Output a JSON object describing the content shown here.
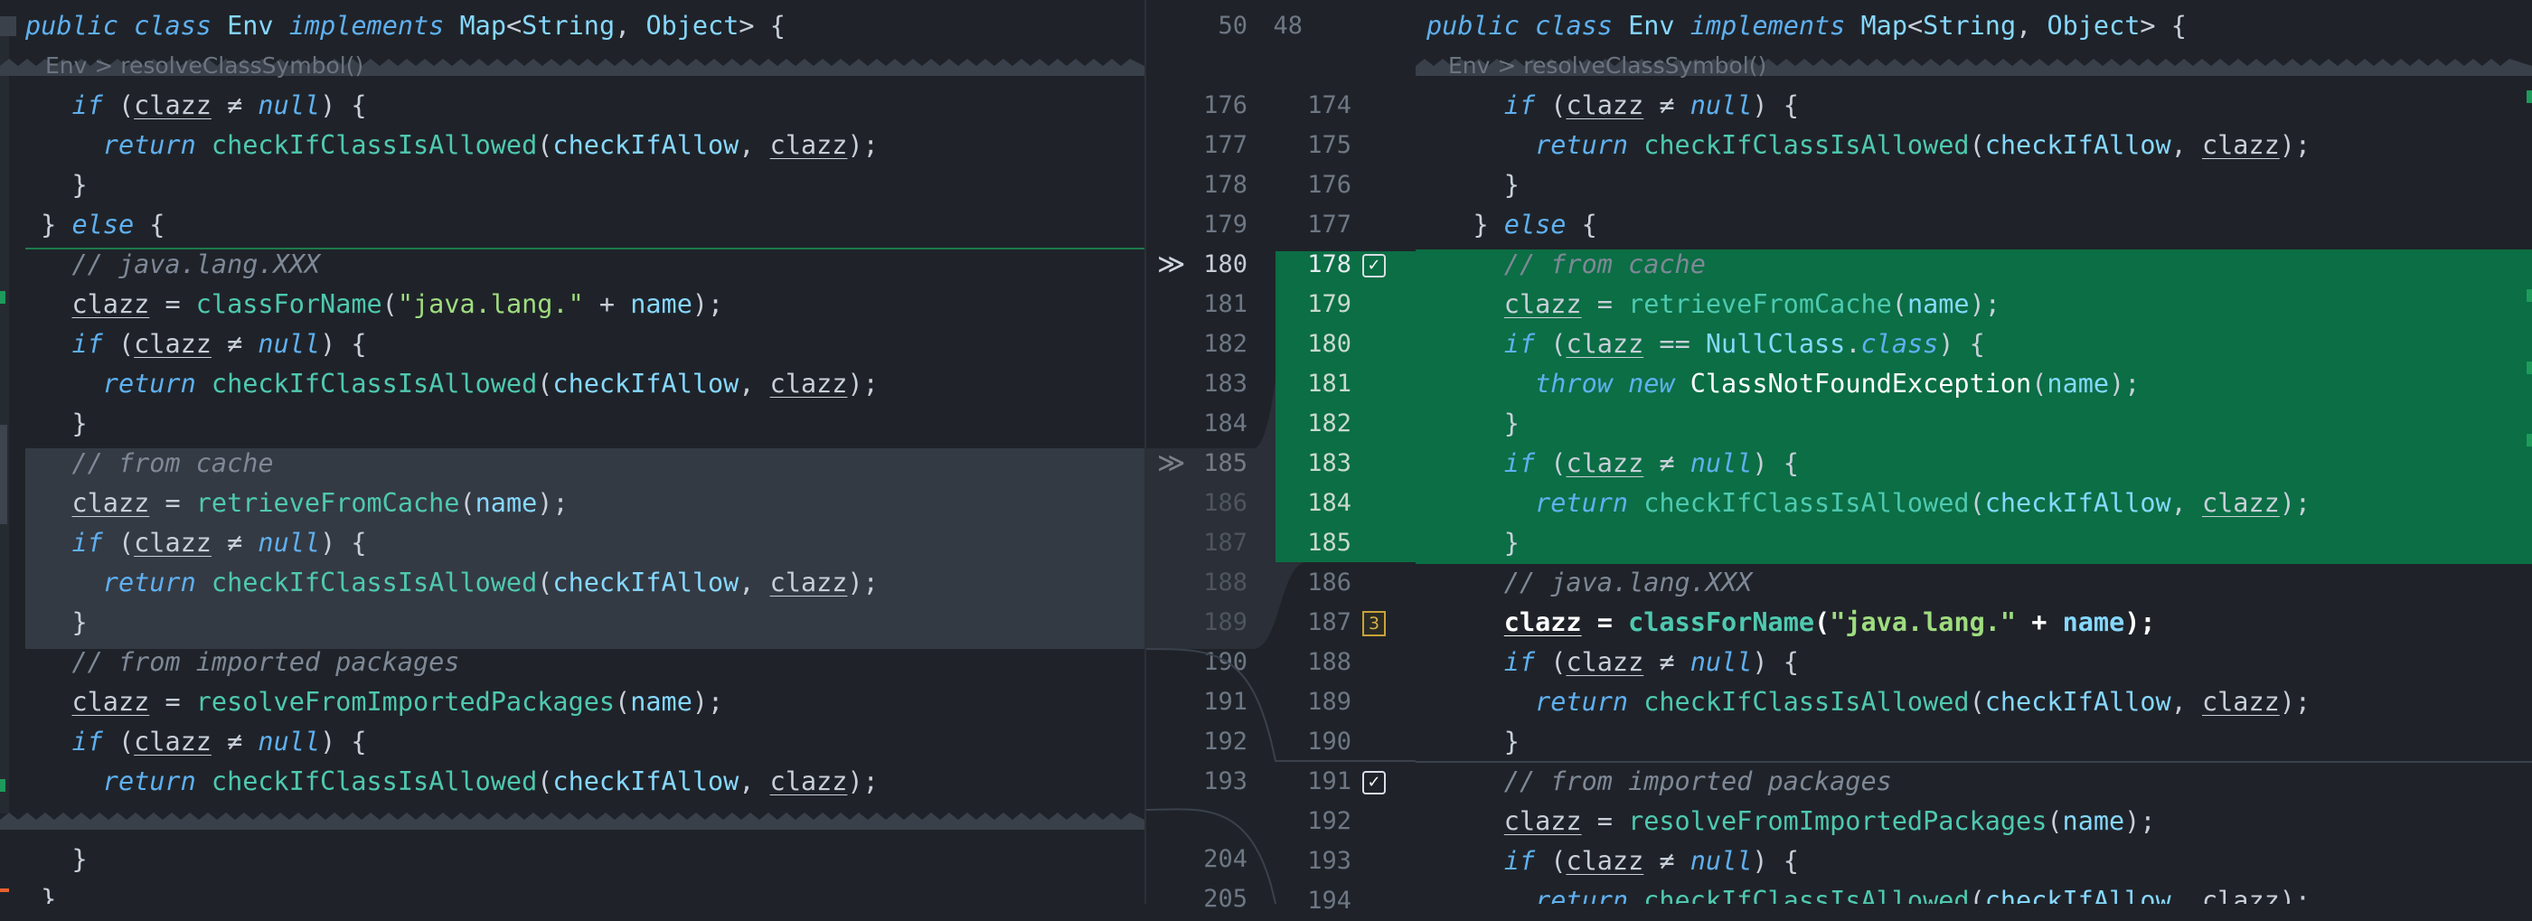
{
  "header_line": {
    "left": "public class Env implements Map<String, Object> {",
    "right": "public class Env implements Map<String, Object> {",
    "left_num": "50",
    "right_num": "48"
  },
  "breadcrumb": "Env > resolveClassSymbol()",
  "left_numbers": [
    "176",
    "177",
    "178",
    "179",
    "180",
    "181",
    "182",
    "183",
    "184",
    "185",
    "186",
    "187",
    "188",
    "189",
    "190",
    "191",
    "192",
    "193",
    "204",
    "205"
  ],
  "right_numbers": [
    "174",
    "175",
    "176",
    "177",
    "178",
    "179",
    "180",
    "181",
    "182",
    "183",
    "184",
    "185",
    "186",
    "187",
    "188",
    "189",
    "190",
    "191",
    "192",
    "193",
    "194"
  ],
  "badge_count": "3",
  "colors": {
    "background": "#1f2329",
    "added_green": "#0b6e45",
    "moved_gray": "#343a43",
    "keyword_blue": "#5fb0f0",
    "function_teal": "#4ec9b0",
    "string_green": "#9fdc7f",
    "comment_gray": "#7e8896"
  }
}
